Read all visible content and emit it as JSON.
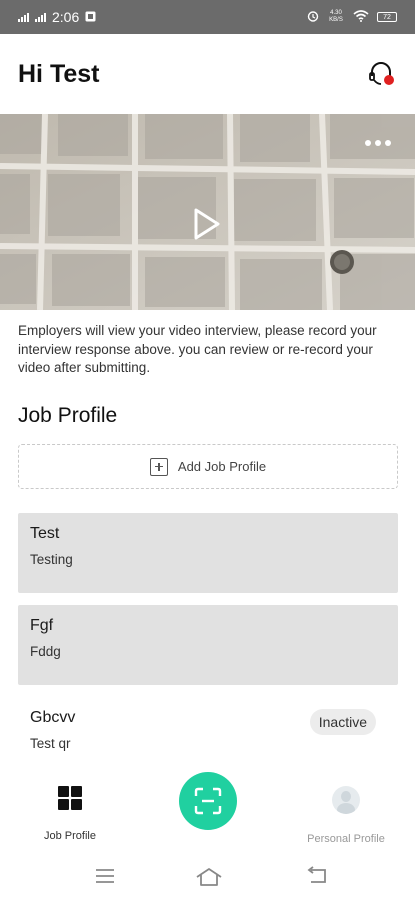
{
  "status_bar": {
    "time": "2:06",
    "network_speed": "4.30 KB/S",
    "battery": "72"
  },
  "header": {
    "greeting": "Hi Test"
  },
  "video": {
    "play_label": "Play"
  },
  "notice": "Employers will view your video interview, please record your interview response above. you can review or re-record your video after submitting.",
  "job_profile": {
    "section_title": "Job Profile",
    "add_label": "Add Job Profile",
    "items": [
      {
        "title": "Test",
        "subtitle": "Testing",
        "status": ""
      },
      {
        "title": "Fgf",
        "subtitle": "Fddg",
        "status": ""
      },
      {
        "title": "Gbcvv",
        "subtitle": "Test qr",
        "status": "Inactive"
      }
    ]
  },
  "bottom_nav": {
    "job_profile_label": "Job Profile",
    "personal_profile_label": "Personal Profile"
  },
  "colors": {
    "accent": "#20d0a0",
    "card_bg": "#e1e1e1",
    "notification_dot": "#e02020"
  }
}
